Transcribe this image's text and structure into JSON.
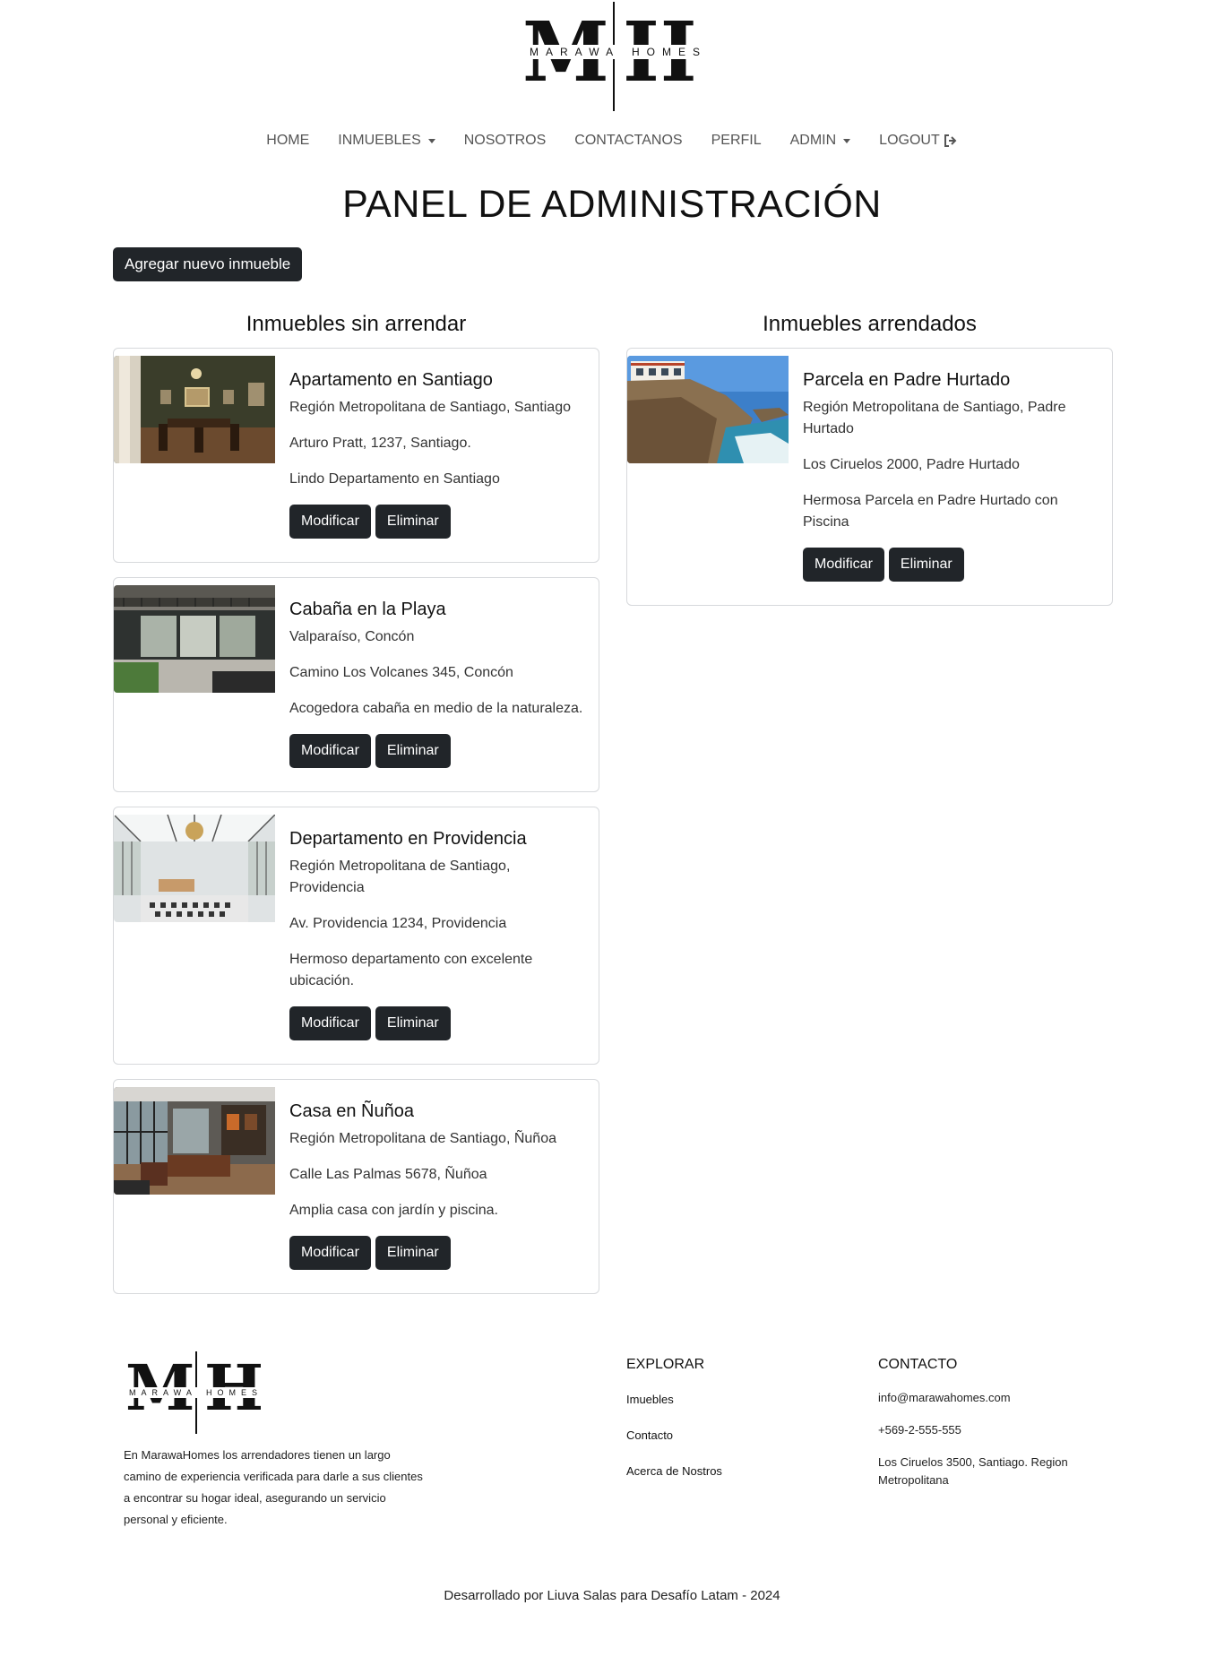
{
  "brand": {
    "logo_letters": "MH",
    "logo_band_left": "MARAWA",
    "logo_band_right": "HOMES"
  },
  "nav": {
    "items": [
      {
        "label": "HOME"
      },
      {
        "label": "INMUEBLES"
      },
      {
        "label": "NOSOTROS"
      },
      {
        "label": "CONTACTANOS"
      },
      {
        "label": "PERFIL"
      },
      {
        "label": "ADMIN"
      },
      {
        "label": "LOGOUT"
      }
    ],
    "icons": {
      "dropdown": "chevron-down-icon",
      "logout": "sign-out-icon"
    }
  },
  "page": {
    "title": "PANEL DE ADMINISTRACIÓN",
    "add_button": "Agregar nuevo inmueble"
  },
  "unrented": {
    "heading": "Inmuebles sin arrendar",
    "cards": [
      {
        "title": "Apartamento en Santiago",
        "region": "Región Metropolitana de Santiago, Santiago",
        "address": "Arturo Pratt, 1237, Santiago.",
        "description": "Lindo Departamento en Santiago",
        "image": "dining-room-photo",
        "modify": "Modificar",
        "delete": "Eliminar"
      },
      {
        "title": "Cabaña en la Playa",
        "region": "Valparaíso, Concón",
        "address": "Camino Los Volcanes 345, Concón",
        "description": "Acogedora cabaña en medio de la naturaleza.",
        "image": "house-facade-photo",
        "modify": "Modificar",
        "delete": "Eliminar"
      },
      {
        "title": "Departamento en Providencia",
        "region": "Región Metropolitana de Santiago, Providencia",
        "address": "Av. Providencia 1234, Providencia",
        "description": "Hermoso departamento con excelente ubicación.",
        "image": "sunroom-photo",
        "modify": "Modificar",
        "delete": "Eliminar"
      },
      {
        "title": "Casa en Ñuñoa",
        "region": "Región Metropolitana de Santiago, Ñuñoa",
        "address": "Calle Las Palmas 5678, Ñuñoa",
        "description": "Amplia casa con jardín y piscina.",
        "image": "living-room-photo",
        "modify": "Modificar",
        "delete": "Eliminar"
      }
    ]
  },
  "rented": {
    "heading": "Inmuebles arrendados",
    "cards": [
      {
        "title": "Parcela en Padre Hurtado",
        "region": "Región Metropolitana de Santiago, Padre Hurtado",
        "address": "Los Ciruelos 2000, Padre Hurtado",
        "description": "Hermosa Parcela en Padre Hurtado con Piscina",
        "image": "coastal-house-photo",
        "modify": "Modificar",
        "delete": "Eliminar"
      }
    ]
  },
  "footer": {
    "about": "En MarawaHomes los arrendadores tienen un largo camino de experiencia verificada para darle a sus clientes a encontrar su hogar ideal, asegurando un servicio personal y eficiente.",
    "explore_title": "EXPLORAR",
    "explore_links": [
      "Imuebles",
      "Contacto",
      "Acerca de Nostros"
    ],
    "contact_title": "CONTACTO",
    "email": "info@marawahomes.com",
    "phone": "+569-2-555-555",
    "address": "Los Ciruelos 3500, Santiago. Region Metropolitana",
    "credits": "Desarrollado por Liuva Salas para Desafío Latam - 2024"
  }
}
